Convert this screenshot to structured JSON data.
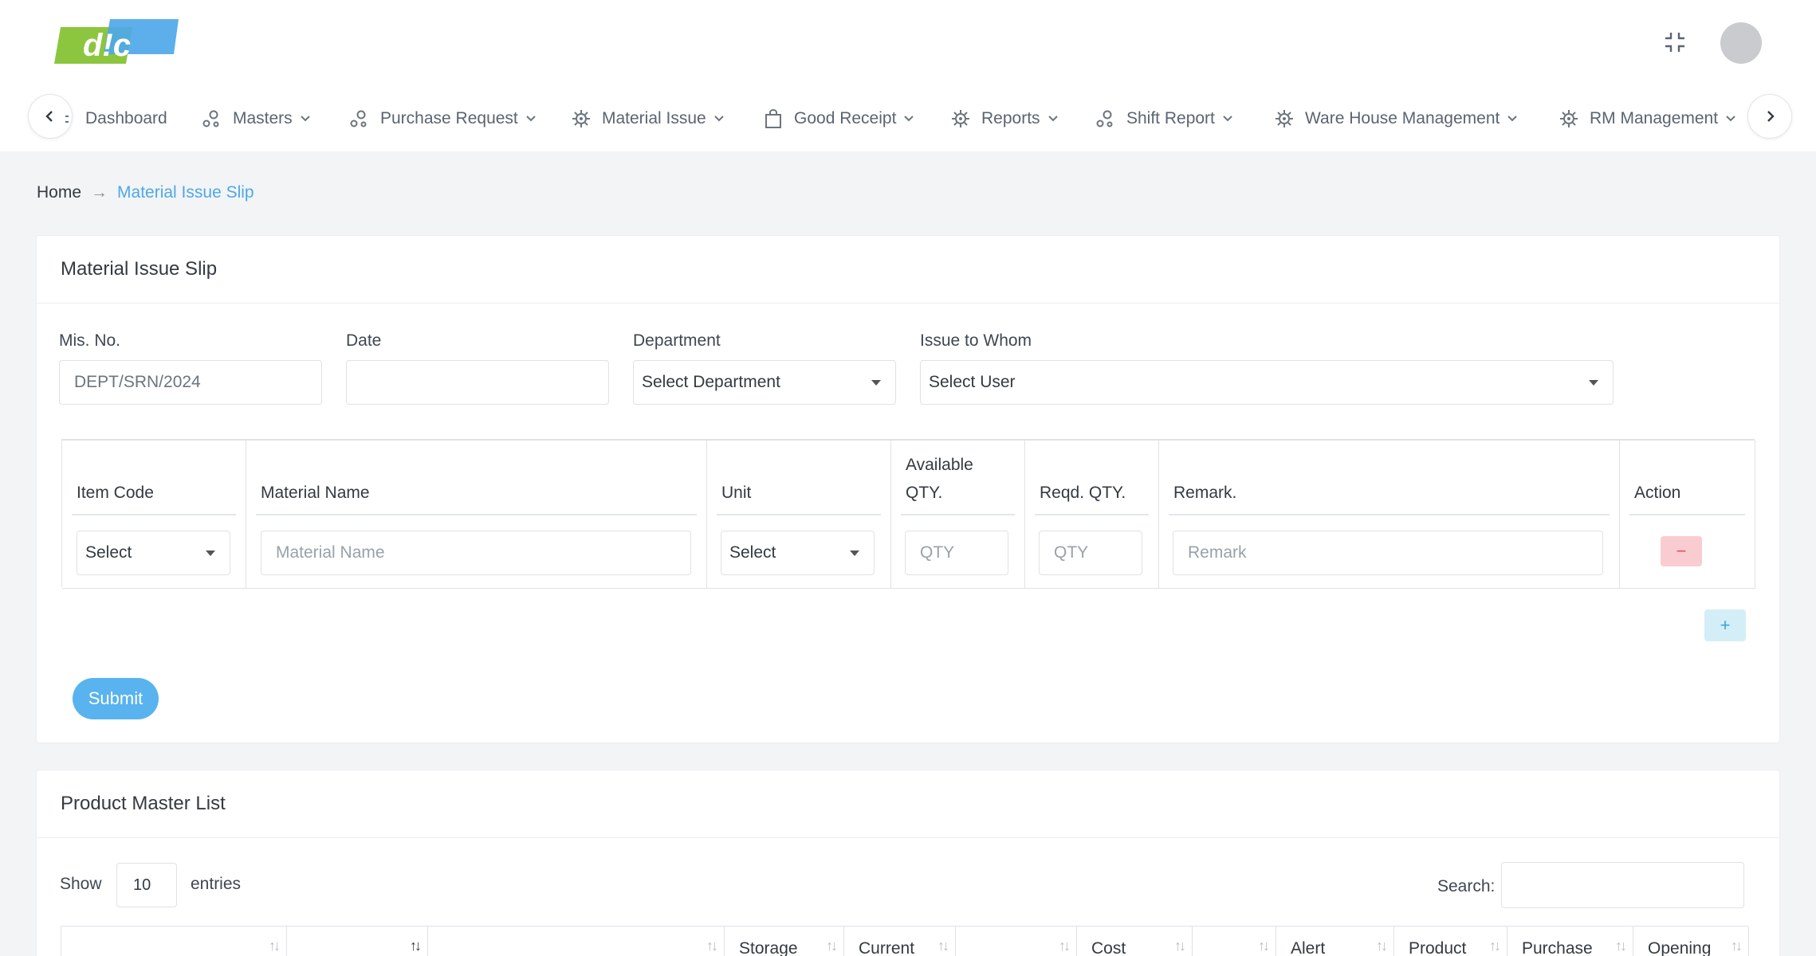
{
  "colors": {
    "accent": "#4ea8e8",
    "submit": "#58b3ef",
    "remove_bg": "#f9ccd1",
    "add_bg": "#d4eef8",
    "logo_green": "#8cc63f",
    "logo_blue": "#4ea8e8"
  },
  "header": {
    "logo_text": "d!c"
  },
  "nav": {
    "items": [
      {
        "label": "Dashboard",
        "icon": "partial-icon"
      },
      {
        "label": "Masters",
        "icon": "circles-icon"
      },
      {
        "label": "Purchase Request",
        "icon": "circles-icon"
      },
      {
        "label": "Material Issue",
        "icon": "gear-icon"
      },
      {
        "label": "Good Receipt",
        "icon": "bag-icon"
      },
      {
        "label": "Reports",
        "icon": "gear-icon"
      },
      {
        "label": "Shift Report",
        "icon": "circles-icon"
      },
      {
        "label": "Ware House Management",
        "icon": "gear-icon"
      },
      {
        "label": "RM Management",
        "icon": "gear-icon"
      }
    ]
  },
  "breadcrumb": {
    "home": "Home",
    "separator": "→",
    "current": "Material Issue Slip"
  },
  "form": {
    "title": "Material Issue Slip",
    "mis_no": {
      "label": "Mis. No.",
      "value": "DEPT/SRN/2024"
    },
    "date": {
      "label": "Date",
      "value": ""
    },
    "department": {
      "label": "Department",
      "value": "Select Department"
    },
    "issue_to": {
      "label": "Issue to Whom",
      "value": "Select User"
    },
    "table": {
      "headers": {
        "item_code": "Item Code",
        "material_name": "Material Name",
        "unit": "Unit",
        "available_qty_1": "Available",
        "available_qty_2": "QTY.",
        "reqd_qty": "Reqd. QTY.",
        "remark": "Remark.",
        "action": "Action"
      },
      "row": {
        "item_code": "Select",
        "material_name_placeholder": "Material Name",
        "unit": "Select",
        "available_placeholder": "QTY",
        "reqd_placeholder": "QTY",
        "remark_placeholder": "Remark",
        "remove_label": "−"
      }
    },
    "add_label": "+",
    "submit_label": "Submit"
  },
  "product_list": {
    "title": "Product Master List",
    "show_label": "Show",
    "length_value": "10",
    "entries_label": "entries",
    "search_label": "Search:",
    "columns": [
      "",
      "",
      "",
      "Storage",
      "Current",
      "",
      "Cost",
      "",
      "Alert",
      "Product",
      "Purchase",
      "Opening"
    ]
  }
}
